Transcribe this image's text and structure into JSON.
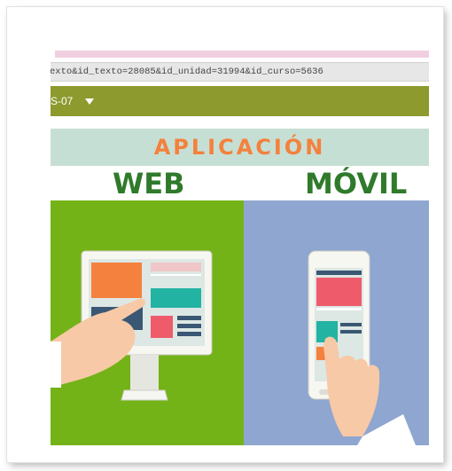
{
  "browser": {
    "url_fragment": "exto&id_texto=28085&id_unidad=31994&id_curso=5636"
  },
  "nav": {
    "label": "S-07"
  },
  "banner": {
    "title": "APLICACIÓN",
    "left_label": "WEB",
    "right_label": "MÓVIL"
  },
  "colors": {
    "nav_bg": "#8c9a2e",
    "title_bg": "#c6dfd4",
    "title_text": "#f4813d",
    "label_text": "#2f7a2b",
    "web_panel": "#73b317",
    "mobile_panel": "#8ea6d0"
  }
}
